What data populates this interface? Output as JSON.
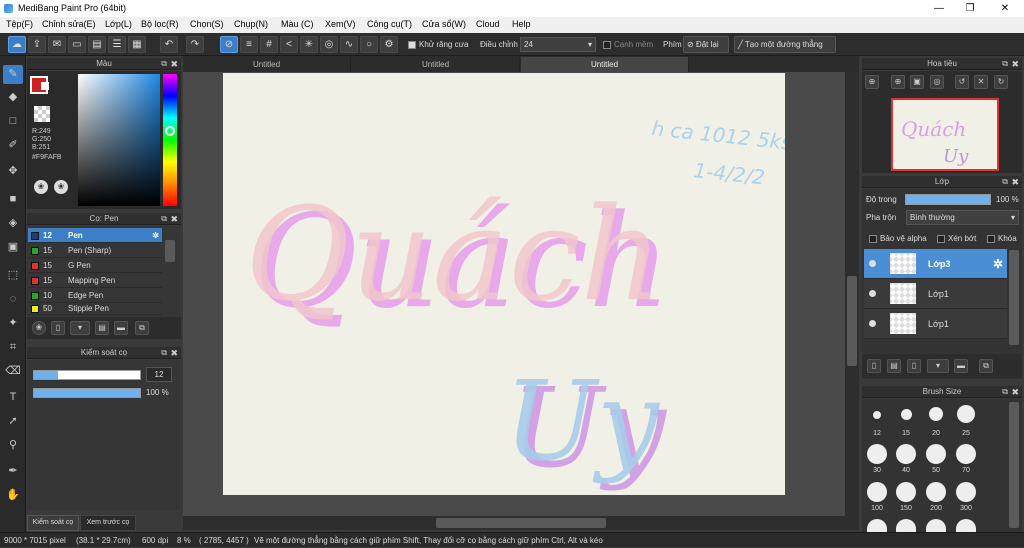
{
  "window": {
    "title": "MediBang Paint Pro (64bit)",
    "min": "—",
    "max": "❐",
    "close": "✕"
  },
  "menu": [
    "Tệp(F)",
    "Chỉnh sửa(E)",
    "Lớp(L)",
    "Bộ lọc(R)",
    "Chọn(S)",
    "Chụp(N)",
    "Màu (C)",
    "Xem(V)",
    "Công cụ(T)",
    "Cửa sổ(W)",
    "Cloud",
    "Help"
  ],
  "toolbar": {
    "antialias_label": "Khử răng cưa",
    "adjust_label": "Điều chỉnh",
    "adjust_value": "24",
    "canh_mem_label": "Cạnh mềm",
    "phim_label": "Phím",
    "dat_lai_label": "Đặt lại",
    "straight_line_label": "Tạo một đường thẳng"
  },
  "color_panel": {
    "title": "Màu",
    "r": "R:249",
    "g": "G:250",
    "b": "B:251",
    "hex": "#F9FAFB",
    "primary": "#cc2222",
    "secondary": "#ffffff"
  },
  "brush_panel": {
    "title": "Cọ: Pen",
    "items": [
      {
        "size": "12",
        "name": "Pen",
        "color": "#1a3f73"
      },
      {
        "size": "15",
        "name": "Pen (Sharp)",
        "color": "#22aa22"
      },
      {
        "size": "15",
        "name": "G Pen",
        "color": "#dd3333"
      },
      {
        "size": "15",
        "name": "Mapping Pen",
        "color": "#dd3333"
      },
      {
        "size": "10",
        "name": "Edge Pen",
        "color": "#22aa22"
      },
      {
        "size": "50",
        "name": "Stipple Pen",
        "color": "#eeee22"
      }
    ]
  },
  "brush_control": {
    "title": "Kiểm soát cọ",
    "size": "12",
    "opacity": "100 %"
  },
  "bottom_tabs": [
    "Kiểm soát cọ",
    "Xem trước cọ"
  ],
  "tabs": [
    "Untitled",
    "Untitled",
    "Untitled"
  ],
  "canvas": {
    "bg": "#f1f0e6",
    "main_word_1": "Quách",
    "main_word_2": "Uy",
    "scribble_1": "h ca 1012 5ks",
    "scribble_2": "1-4/2/2"
  },
  "navigator": {
    "title": "Hoa tiêu",
    "thumb_text_1": "Quách",
    "thumb_text_2": "Uy"
  },
  "layer_panel": {
    "title": "Lớp",
    "opacity_label": "Độ trong",
    "opacity_value": "100 %",
    "opacity_fraction": 1.0,
    "blend_label": "Pha trộn",
    "blend_value": "Bình thường",
    "protect_alpha": "Bảo vệ alpha",
    "clipping": "Xén bớt",
    "lock": "Khóa",
    "layers": [
      {
        "name": "Lớp3",
        "selected": true
      },
      {
        "name": "Lớp1",
        "selected": false
      },
      {
        "name": "Lớp1",
        "selected": false
      }
    ]
  },
  "brush_size_panel": {
    "title": "Brush Size",
    "sizes": [
      "12",
      "15",
      "20",
      "25",
      "30",
      "40",
      "50",
      "70",
      "100",
      "150",
      "200",
      "300"
    ]
  },
  "status": {
    "size": "9000 * 7015 pixel",
    "cm": "(38.1 * 29.7cm)",
    "dpi": "600 dpi",
    "zoom": "8 %",
    "coords": "( 2785, 4457 )",
    "hint": "Vẽ một đường thẳng bằng cách giữ phím Shift, Thay đổi cỡ cọ bằng cách giữ phím Ctrl, Alt và kéo"
  }
}
